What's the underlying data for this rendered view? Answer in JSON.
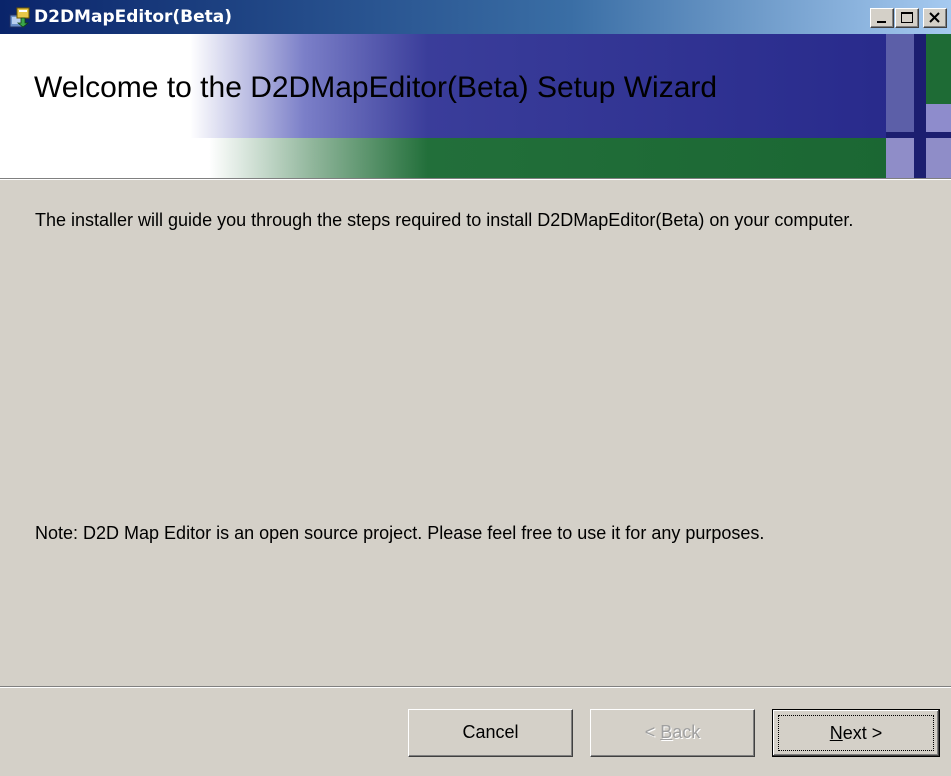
{
  "window": {
    "title": "D2DMapEditor(Beta)"
  },
  "banner": {
    "title": "Welcome to the D2DMapEditor(Beta) Setup Wizard"
  },
  "content": {
    "intro": "The installer will guide you through the steps required to install D2DMapEditor(Beta) on your computer.",
    "note": "Note: D2D Map Editor is an open source project. Please feel free to use it for any purposes."
  },
  "buttons": {
    "cancel_label": "Cancel",
    "back_prefix": "< ",
    "back_accel": "B",
    "back_rest": "ack",
    "next_accel": "N",
    "next_rest": "ext >"
  },
  "icons": {
    "app": "installer-icon",
    "minimize": "minimize-icon",
    "maximize": "maximize-icon",
    "close": "close-icon"
  },
  "colors": {
    "titlebar_start": "#0a246a",
    "titlebar_end": "#a6caf0",
    "banner_blue": "#2d2e8f",
    "banner_green": "#1e6b35",
    "dialog_face": "#d4d0c8"
  }
}
